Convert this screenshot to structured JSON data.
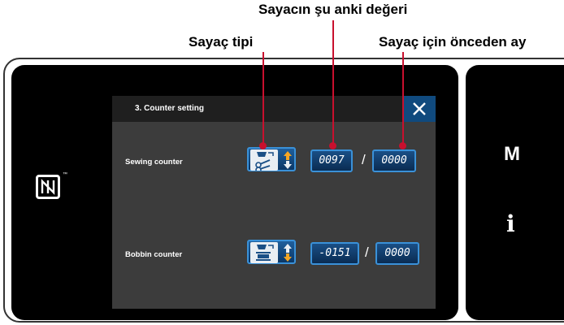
{
  "annotations": {
    "current_value": "Sayacın şu anki değeri",
    "counter_type": "Sayaç tipi",
    "preset_value": "Sayaç için önceden ay"
  },
  "screen": {
    "title": "3.    Counter setting",
    "rows": [
      {
        "label": "Sewing counter",
        "type_icon": "scissors-presser-icon",
        "current_value": "0097",
        "separator": "/",
        "preset_value": "0000"
      },
      {
        "label": "Bobbin counter",
        "type_icon": "bobbin-icon",
        "current_value": "-0151",
        "separator": "/",
        "preset_value": "0000"
      }
    ]
  },
  "side_keys": {
    "mode": "M",
    "info": "i"
  },
  "icons": {
    "close": "close-icon",
    "nfc": "nfc-icon"
  },
  "colors": {
    "accent": "#3a91d8",
    "callout": "#c8102e",
    "arrow_up": "#f5a623"
  }
}
